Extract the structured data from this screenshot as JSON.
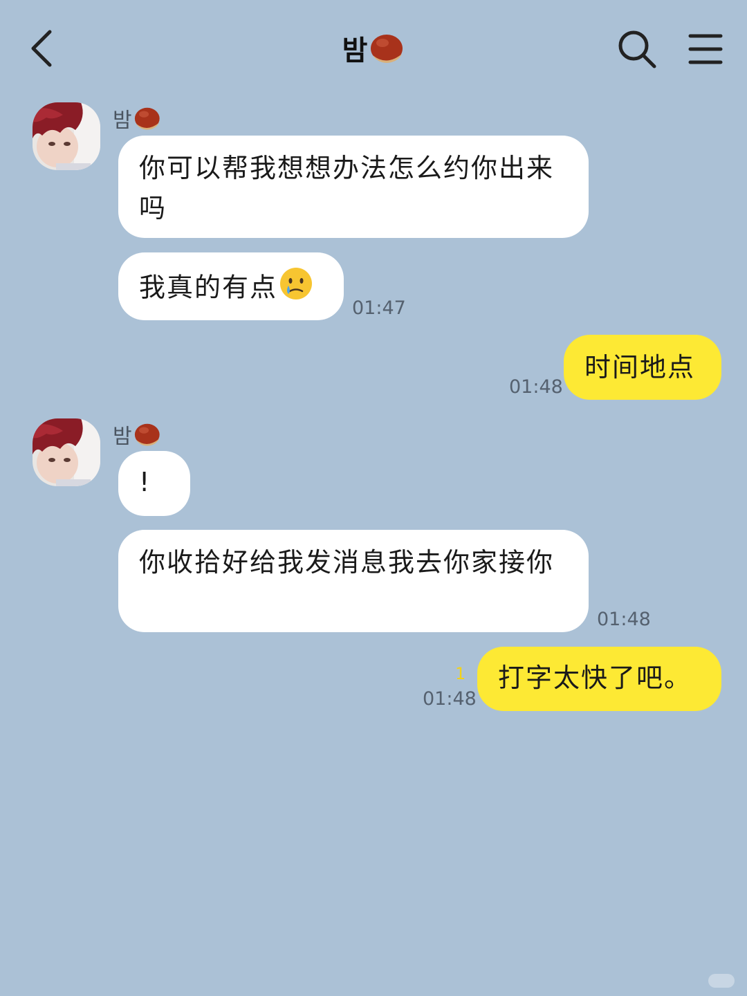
{
  "header": {
    "title": "밤",
    "title_emoji": "chestnut-icon"
  },
  "messages": [
    {
      "side": "left",
      "sender": "밤",
      "text": "你可以帮我想想办法怎么约你出来吗"
    },
    {
      "side": "left",
      "text": "我真的有点",
      "emoji": "crying-face-icon",
      "time": "01:47"
    },
    {
      "side": "right",
      "text": "时间地点",
      "time": "01:48"
    },
    {
      "side": "left",
      "sender": "밤",
      "text": "!"
    },
    {
      "side": "left",
      "text": "你收拾好给我发消息我去你家接你",
      "time": "01:48"
    },
    {
      "side": "right",
      "text": "打字太快了吧。",
      "time": "01:48",
      "unread": "1"
    }
  ],
  "colors": {
    "background": "#abc1d6",
    "bubble_received": "#ffffff",
    "bubble_sent": "#fde934",
    "unread_counter": "#f2d21a"
  }
}
